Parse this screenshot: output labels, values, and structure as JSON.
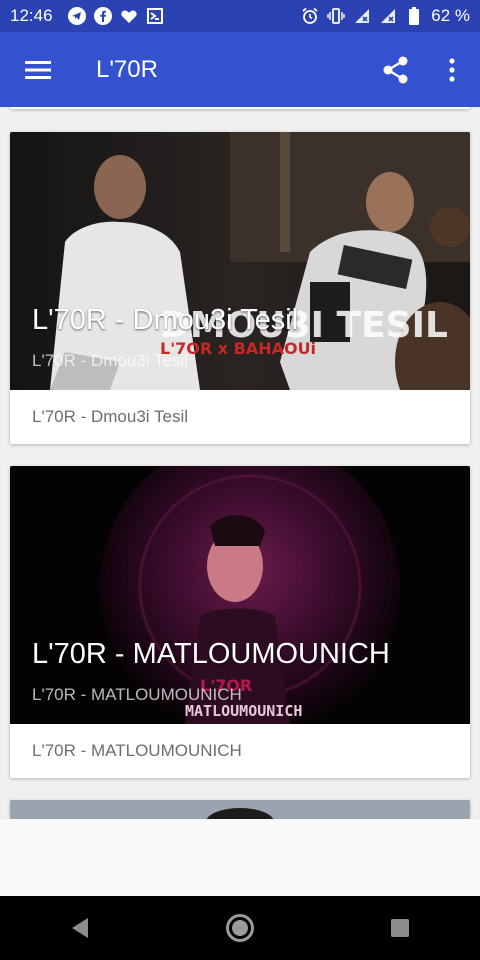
{
  "status_bar": {
    "time": "12:46",
    "battery": "62 %"
  },
  "app_bar": {
    "title": "L'70R"
  },
  "cards": [
    {
      "overlay_title": "L'70R - Dmou3i Tesil",
      "overlay_subtitle": "L'70R - Dmou3i Tesil",
      "footer": "L'70R - Dmou3i Tesil",
      "image_text_top": "DMOU3I TESIL",
      "image_text_bottom": "L'7OR x BAHAOUi"
    },
    {
      "overlay_title": "L'70R - MATLOUMOUNICH",
      "overlay_subtitle": "L'70R - MATLOUMOUNICH",
      "footer": "L'70R - MATLOUMOUNICH",
      "image_text_top": "L'7OR",
      "image_text_bottom": "MATLOUMOUNICH"
    }
  ],
  "colors": {
    "status_bar": "#2b42b3",
    "app_bar": "#3451cf"
  }
}
